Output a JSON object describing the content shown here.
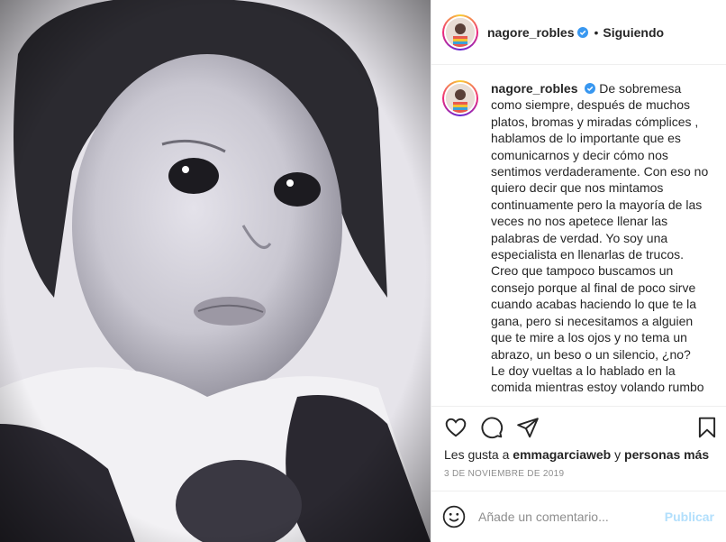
{
  "post": {
    "image_alt_icon": "portrait-photo",
    "author": "nagore_robles",
    "follow_state": "Siguiendo",
    "separator": "•",
    "caption": "De sobremesa como siempre, después de muchos platos, bromas y miradas cómplices , hablamos de lo importante que es comunicarnos y decir cómo nos sentimos verdaderamente. Con eso no quiero decir que nos mintamos continuamente pero la mayoría de las veces no nos apetece llenar las palabras de verdad. Yo soy una especialista en llenarlas de trucos. Creo que tampoco buscamos un consejo porque al final de poco sirve cuando acabas haciendo lo que te la gana, pero si necesitamos a alguien que te mire a los ojos y no tema un abrazo, un beso o un silencio, ¿no?\nLe doy vueltas a lo hablado en la comida mientras estoy volando rumbo"
  },
  "likes": {
    "prefix": "Les gusta a",
    "user": "emmagarciaweb",
    "connector": "y",
    "others": "personas más"
  },
  "date": "3 DE NOVIEMBRE DE 2019",
  "comment": {
    "placeholder": "Añade un comentario...",
    "publish_label": "Publicar"
  },
  "colors": {
    "verified": "#3897f0",
    "publish_disabled": "#b2dffc",
    "muted": "#8e8e8e"
  },
  "icons": [
    "heart-icon",
    "comment-icon",
    "share-icon",
    "bookmark-icon",
    "emoji-icon",
    "verified-badge-icon"
  ]
}
